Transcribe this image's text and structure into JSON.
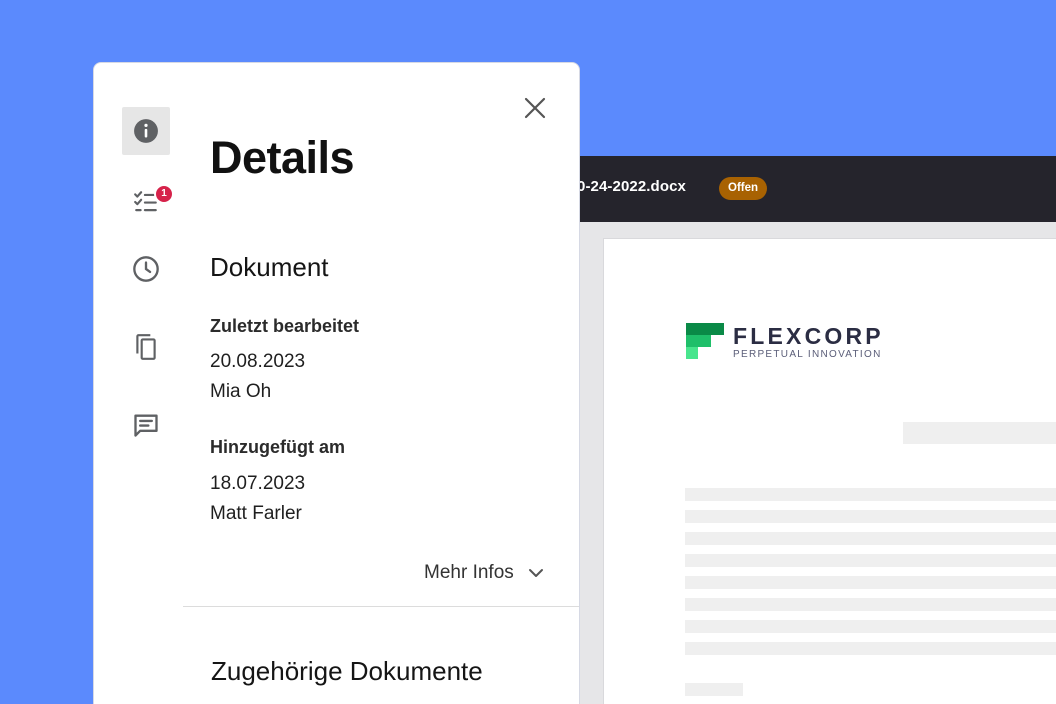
{
  "viewer": {
    "filename": "0-24-2022.docx",
    "status": "Offen",
    "logo": {
      "name": "FLEXCORP",
      "tagline": "PERPETUAL INNOVATION"
    }
  },
  "panel": {
    "title": "Details",
    "rail": [
      {
        "icon": "info-icon",
        "active": true
      },
      {
        "icon": "checklist-icon",
        "badge": "1"
      },
      {
        "icon": "clock-icon"
      },
      {
        "icon": "copy-icon"
      },
      {
        "icon": "comment-icon"
      }
    ],
    "document": {
      "heading": "Dokument",
      "last_edited_label": "Zuletzt bearbeitet",
      "last_edited_date": "20.08.2023",
      "last_edited_by": "Mia Oh",
      "added_label": "Hinzugefügt am",
      "added_date": "18.07.2023",
      "added_by": "Matt Farler",
      "more_label": "Mehr Infos"
    },
    "related": {
      "heading": "Zugehörige Dokumente"
    }
  },
  "colors": {
    "background": "#5b8afd",
    "status_badge": "#a86202",
    "notification_badge": "#d6224a",
    "logo_green_dark": "#0a8a47",
    "logo_green_light": "#48e58d"
  }
}
